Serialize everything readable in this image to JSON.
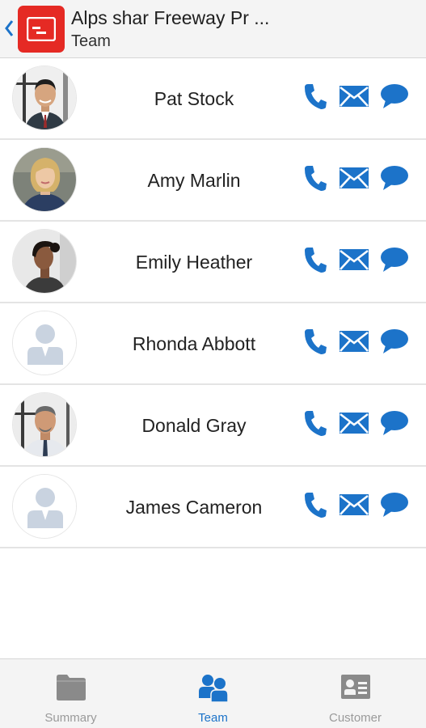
{
  "header": {
    "title": "Alps shar Freeway Pr ...",
    "subtitle": "Team"
  },
  "colors": {
    "accent": "#1c73c9",
    "app_icon": "#e52a24",
    "inactive_tab": "#8a8a8a"
  },
  "team": [
    {
      "name": "Pat Stock",
      "avatar": "photo"
    },
    {
      "name": "Amy Marlin",
      "avatar": "photo"
    },
    {
      "name": "Emily Heather",
      "avatar": "photo"
    },
    {
      "name": "Rhonda Abbott",
      "avatar": "placeholder"
    },
    {
      "name": "Donald Gray",
      "avatar": "photo"
    },
    {
      "name": "James Cameron",
      "avatar": "placeholder"
    }
  ],
  "row_actions": [
    "phone-icon",
    "mail-icon",
    "chat-icon"
  ],
  "tabs": [
    {
      "label": "Summary",
      "icon": "folder-icon",
      "active": false
    },
    {
      "label": "Team",
      "icon": "team-icon",
      "active": true
    },
    {
      "label": "Customer",
      "icon": "contact-card-icon",
      "active": false
    }
  ]
}
